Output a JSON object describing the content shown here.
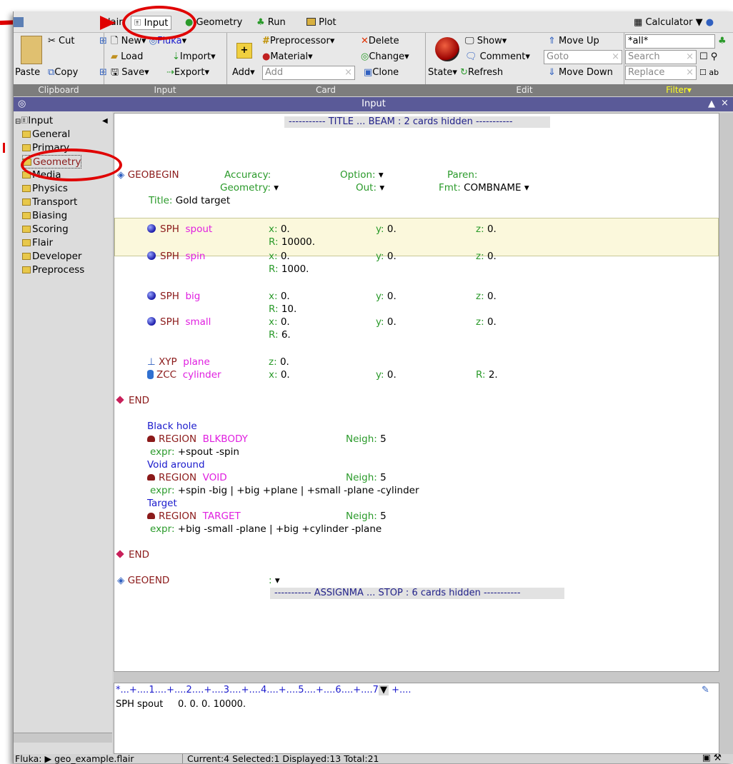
{
  "menubar": {
    "flair": "lair",
    "input_tab": "Input",
    "geometry_tab": "Geometry",
    "run_tab": "Run",
    "plot_tab": "Plot",
    "calculator": "Calculator"
  },
  "ribbon": {
    "cut": "Cut",
    "paste": "Paste",
    "copy": "Copy",
    "new": "New",
    "fluka": "Fluka",
    "load": "Load",
    "import": "Import",
    "save": "Save",
    "export": "Export",
    "preprocessor": "Preprocessor",
    "delete": "Delete",
    "material": "Material",
    "change": "Change",
    "add": "Add",
    "add_placeholder": "Add",
    "clone": "Clone",
    "show": "Show",
    "move_up": "Move Up",
    "comment": "Comment",
    "goto_placeholder": "Goto",
    "state": "State",
    "refresh": "Refresh",
    "move_down": "Move Down",
    "filter_value": "*all*",
    "search_placeholder": "Search",
    "replace_placeholder": "Replace",
    "labels": {
      "clipboard": "Clipboard",
      "input": "Input",
      "card": "Card",
      "edit": "Edit",
      "filter": "Filter"
    }
  },
  "titlebar": {
    "title": "Input",
    "collapse_glyph": "▲",
    "close_glyph": "×"
  },
  "tree": {
    "root": "Input",
    "items": [
      "General",
      "Primary",
      "Geometry",
      "Media",
      "Physics",
      "Transport",
      "Biasing",
      "Scoring",
      "Flair",
      "Developer",
      "Preprocess"
    ]
  },
  "editor": {
    "hidden_top": "----------- TITLE ... BEAM : 2 cards hidden -----------",
    "geobegin": {
      "card": "GEOBEGIN",
      "accuracy_label": "Accuracy:",
      "option_label": "Option:",
      "paren_label": "Paren:",
      "geometry_label": "Geometry:",
      "out_label": "Out:",
      "fmt_label": "Fmt:",
      "fmt_value": "COMBNAME",
      "title_label": "Title:",
      "title_value": "Gold target"
    },
    "bodies": [
      {
        "type": "SPH",
        "name": "spout",
        "x": "0.",
        "y": "0.",
        "z": "0.",
        "r": "10000."
      },
      {
        "type": "SPH",
        "name": "spin",
        "x": "0.",
        "y": "0.",
        "z": "0.",
        "r": "1000."
      },
      {
        "type": "SPH",
        "name": "big",
        "x": "0.",
        "y": "0.",
        "z": "0.",
        "r": "10."
      },
      {
        "type": "SPH",
        "name": "small",
        "x": "0.",
        "y": "0.",
        "z": "0.",
        "r": "6."
      }
    ],
    "xyp": {
      "type": "XYP",
      "name": "plane",
      "z": "0."
    },
    "zcc": {
      "type": "ZCC",
      "name": "cylinder",
      "x": "0.",
      "y": "0.",
      "r": "2."
    },
    "labels": {
      "x": "x:",
      "y": "y:",
      "z": "z:",
      "r": "R:",
      "neigh": "Neigh:",
      "expr": "expr:"
    },
    "end": "END",
    "regions": [
      {
        "comment": "Black hole",
        "card": "REGION",
        "name": "BLKBODY",
        "neigh": "5",
        "expr": "+spout -spin"
      },
      {
        "comment": "Void around",
        "card": "REGION",
        "name": "VOID",
        "neigh": "5",
        "expr": "+spin -big | +big +plane | +small -plane -cylinder"
      },
      {
        "comment": "Target",
        "card": "REGION",
        "name": "TARGET",
        "neigh": "5",
        "expr": "+big -small -plane | +big +cylinder -plane"
      }
    ],
    "geoend": "GEOEND",
    "geoend_colon": ":",
    "hidden_bottom": "----------- ASSIGNMA ... STOP : 6 cards hidden -----------"
  },
  "cmd": {
    "ruler": "*...+....1....+....2....+....3....+....4....+....5....+....6....+....7",
    "ruler_tail": "+....",
    "line": "SPH spout     0. 0. 0. 10000."
  },
  "status": {
    "file_label": "Fluka:",
    "file": "geo_example.flair",
    "counts": "Current:4 Selected:1 Displayed:13 Total:21"
  },
  "colors": {
    "annotation": "#e00000",
    "titlebar": "#5a5a98",
    "keyword": "#8b1a1a",
    "name": "#e020e0",
    "label": "#2a9a2a"
  }
}
